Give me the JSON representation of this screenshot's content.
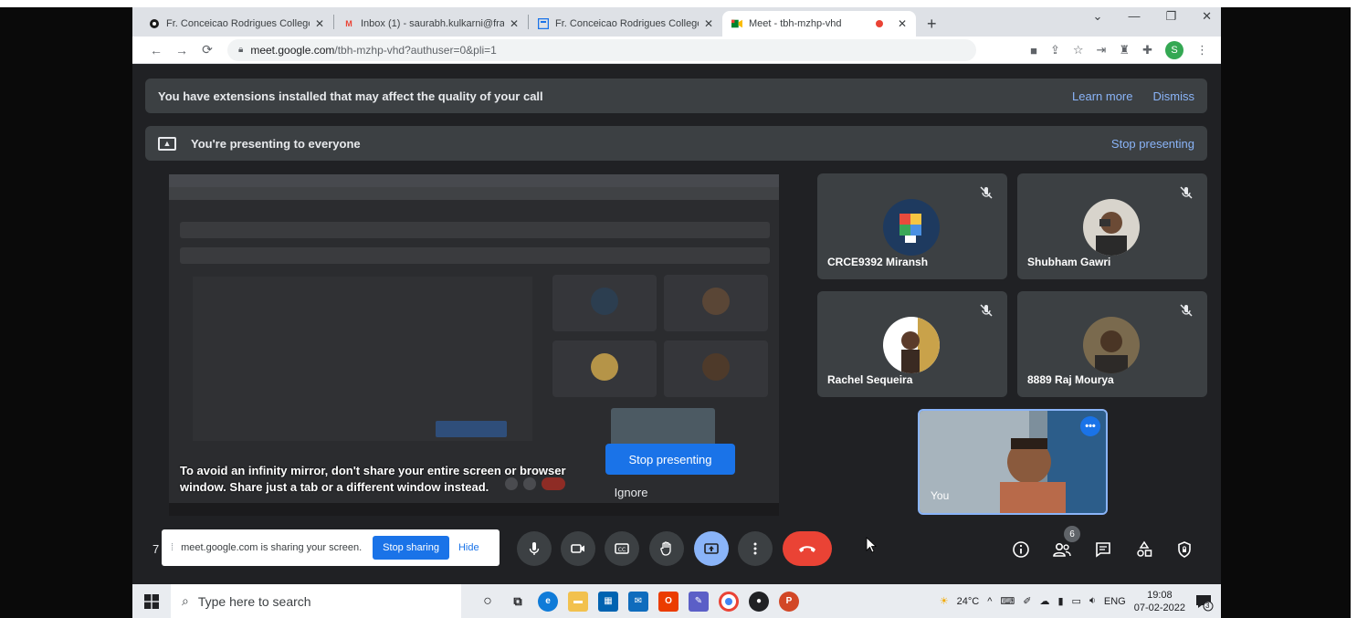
{
  "browser": {
    "tabs": [
      {
        "title": "Fr. Conceicao Rodrigues College",
        "favicon_color": "#1a1a1a"
      },
      {
        "title": "Inbox (1) - saurabh.kulkarni@fra",
        "favicon_color": "#ea4335"
      },
      {
        "title": "Fr. Conceicao Rodrigues College",
        "favicon_color": "#1a73e8"
      },
      {
        "title": "Meet - tbh-mzhp-vhd",
        "favicon_color": "#00832d",
        "active": true
      }
    ],
    "url_host": "meet.google.com",
    "url_path": "/tbh-mzhp-vhd?authuser=0&pli=1",
    "profile_initial": "S"
  },
  "banners": {
    "extensions_text": "You have extensions installed that may affect the quality of your call",
    "learn_more": "Learn more",
    "dismiss": "Dismiss",
    "presenting_text": "You're presenting to everyone",
    "stop_presenting": "Stop presenting"
  },
  "presentation": {
    "warning": "To avoid an infinity mirror, don't share your entire screen or browser window. Share just a tab or a different window instead.",
    "stop_button": "Stop presenting",
    "ignore_button": "Ignore"
  },
  "participants": [
    {
      "name": "CRCE9392 Miransh",
      "avatar_color": "#1e3a5f",
      "muted": true
    },
    {
      "name": "Shubham Gawri",
      "avatar_color": "#3b3b3b",
      "muted": true
    },
    {
      "name": "Rachel Sequeira",
      "avatar_color": "#c9a24a",
      "muted": true
    },
    {
      "name": "8889 Raj Mourya",
      "avatar_color": "#4a3525",
      "muted": true
    }
  ],
  "self_view": {
    "label": "You",
    "more": "•••"
  },
  "controls": {
    "meeting_code_visible": "7",
    "share_notice": "meet.google.com is sharing your screen.",
    "stop_sharing": "Stop sharing",
    "hide": "Hide",
    "people_count": "6"
  },
  "taskbar": {
    "search_placeholder": "Type here to search",
    "temperature": "24°C",
    "language": "ENG",
    "time": "19:08",
    "date": "07-02-2022",
    "notification_count": "3"
  }
}
